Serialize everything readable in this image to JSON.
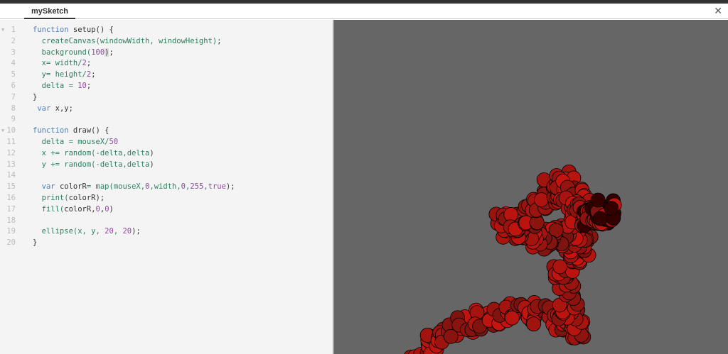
{
  "tab": {
    "title": "mySketch",
    "close_icon": "close-icon"
  },
  "code": [
    {
      "n": "1",
      "fold": true,
      "t": [
        [
          "function",
          "kw"
        ],
        [
          " setup() {",
          "pl"
        ]
      ]
    },
    {
      "n": "2",
      "t": [
        [
          "  createCanvas(windowWidth, windowHeight)",
          "fn"
        ],
        [
          ";",
          "pl"
        ]
      ]
    },
    {
      "n": "3",
      "t": [
        [
          "  background(",
          "fn"
        ],
        [
          "100",
          "num"
        ],
        [
          ")",
          "hl"
        ],
        [
          ";",
          "pl"
        ]
      ]
    },
    {
      "n": "4",
      "t": [
        [
          "  x= width/",
          "fn"
        ],
        [
          "2",
          "num"
        ],
        [
          ";",
          "pl"
        ]
      ]
    },
    {
      "n": "5",
      "t": [
        [
          "  y= height/",
          "fn"
        ],
        [
          "2",
          "num"
        ],
        [
          ";",
          "pl"
        ]
      ]
    },
    {
      "n": "6",
      "t": [
        [
          "  delta = ",
          "fn"
        ],
        [
          "10",
          "num"
        ],
        [
          ";",
          "pl"
        ]
      ]
    },
    {
      "n": "7",
      "t": [
        [
          "}",
          "pl"
        ]
      ]
    },
    {
      "n": "8",
      "t": [
        [
          " ",
          "pl"
        ],
        [
          "var",
          "kw"
        ],
        [
          " x,y;",
          "pl"
        ]
      ]
    },
    {
      "n": "9",
      "t": []
    },
    {
      "n": "10",
      "fold": true,
      "t": [
        [
          "function",
          "kw"
        ],
        [
          " draw() {",
          "pl"
        ]
      ]
    },
    {
      "n": "11",
      "t": [
        [
          "  delta = mouseX/",
          "fn"
        ],
        [
          "50",
          "num"
        ]
      ]
    },
    {
      "n": "12",
      "t": [
        [
          "  x += random(-delta,delta",
          "fn"
        ],
        [
          ")",
          "pl"
        ]
      ]
    },
    {
      "n": "13",
      "t": [
        [
          "  y += random(-delta,delta",
          "fn"
        ],
        [
          ")",
          "pl"
        ]
      ]
    },
    {
      "n": "14",
      "t": []
    },
    {
      "n": "15",
      "t": [
        [
          "  ",
          "pl"
        ],
        [
          "var",
          "kw"
        ],
        [
          " colorR",
          "pl"
        ],
        [
          "= map(mouseX,",
          "fn"
        ],
        [
          "0",
          "num"
        ],
        [
          ",width,",
          "fn"
        ],
        [
          "0",
          "num"
        ],
        [
          ",",
          "fn"
        ],
        [
          "255",
          "num"
        ],
        [
          ",",
          "fn"
        ],
        [
          "true",
          "num"
        ],
        [
          ");",
          "pl"
        ]
      ]
    },
    {
      "n": "16",
      "t": [
        [
          "  print(",
          "fn"
        ],
        [
          "colorR);",
          "pl"
        ]
      ]
    },
    {
      "n": "17",
      "t": [
        [
          "  fill(",
          "fn"
        ],
        [
          "colorR,",
          "pl"
        ],
        [
          "0",
          "num"
        ],
        [
          ",",
          "pl"
        ],
        [
          "0",
          "num"
        ],
        [
          ")",
          "pl"
        ]
      ]
    },
    {
      "n": "18",
      "t": []
    },
    {
      "n": "19",
      "t": [
        [
          "  ellipse(x, y, ",
          "fn"
        ],
        [
          "20",
          "num"
        ],
        [
          ", ",
          "fn"
        ],
        [
          "20",
          "num"
        ],
        [
          ");",
          "pl"
        ]
      ]
    },
    {
      "n": "20",
      "t": [
        [
          "}",
          "pl"
        ]
      ]
    }
  ],
  "canvas": {
    "background": "#666666",
    "fill": "#b01a12",
    "stroke": "#000000"
  }
}
